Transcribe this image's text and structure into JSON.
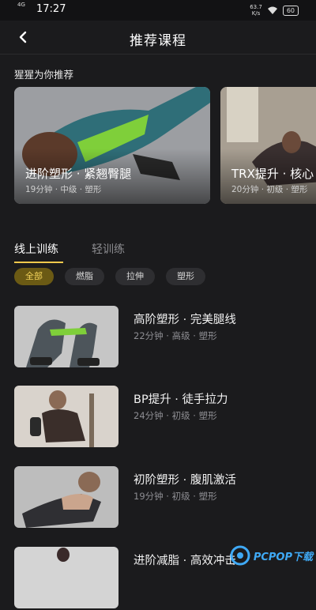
{
  "status": {
    "time": "17:27",
    "signal": "4G",
    "speed": "63.7\nK/s",
    "battery": "60"
  },
  "nav": {
    "title": "推荐课程"
  },
  "recommend": {
    "title": "猩猩为你推荐",
    "cards": [
      {
        "title": "进阶塑形 · 紧翘臀腿",
        "meta": "19分钟 · 中级 · 塑形"
      },
      {
        "title": "TRX提升 · 核心",
        "meta": "20分钟 · 初级 · 塑形"
      }
    ]
  },
  "tabs": [
    {
      "label": "线上训练"
    },
    {
      "label": "轻训练"
    }
  ],
  "filters": [
    {
      "label": "全部"
    },
    {
      "label": "燃脂"
    },
    {
      "label": "拉伸"
    },
    {
      "label": "塑形"
    }
  ],
  "courses": [
    {
      "title": "高阶塑形 · 完美腿线",
      "meta": "22分钟 · 高级 · 塑形"
    },
    {
      "title": "BP提升 · 徒手拉力",
      "meta": "24分钟 · 初级 · 塑形"
    },
    {
      "title": "初阶塑形 · 腹肌激活",
      "meta": "19分钟 · 初级 · 塑形"
    },
    {
      "title": "进阶减脂 · 高效冲击",
      "meta": ""
    }
  ],
  "watermark": {
    "text": "PCPOP下载"
  },
  "colors": {
    "accent": "#f2c94c",
    "background": "#1b1b1d"
  }
}
